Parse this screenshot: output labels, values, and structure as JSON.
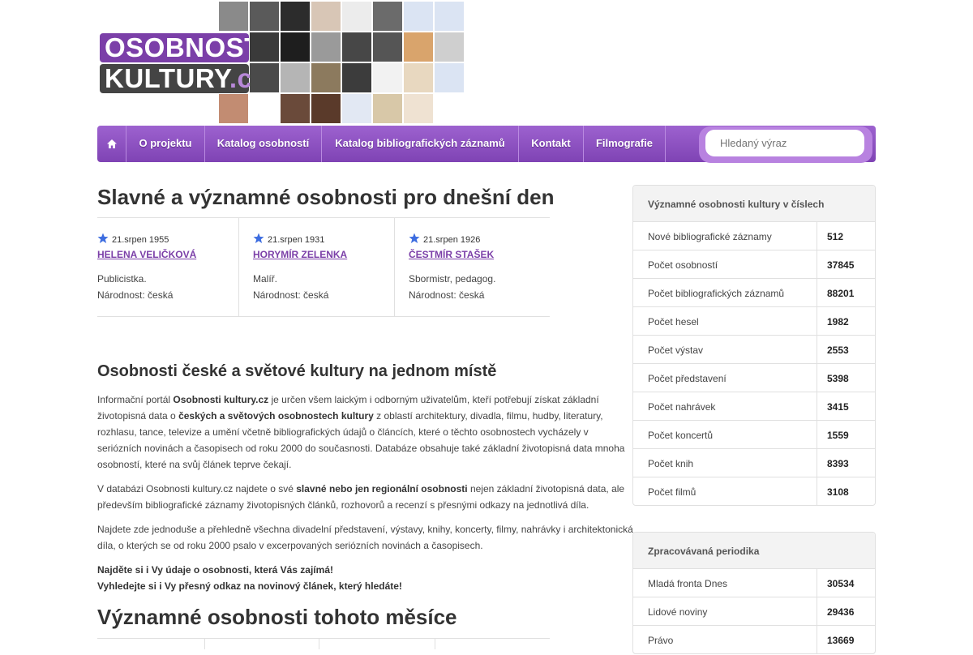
{
  "logo": {
    "line1": "OSOBNOSTI",
    "line2_main": "KULTURY",
    "line2_tld": ".cz"
  },
  "nav": {
    "home_icon": "home-icon",
    "items": [
      "O projektu",
      "Katalog osobností",
      "Katalog bibliografických záznamů",
      "Kontakt",
      "Filmografie"
    ],
    "search_placeholder": "Hledaný výraz"
  },
  "today": {
    "title": "Slavné a významné osobnosti pro dnešní den",
    "people": [
      {
        "date": "21.srpen 1955",
        "name": "HELENA VELIČKOVÁ",
        "desc": "Publicistka.",
        "nat": "Národnost: česká"
      },
      {
        "date": "21.srpen 1931",
        "name": "HORYMÍR ZELENKA",
        "desc": "Malíř.",
        "nat": "Národnost: česká"
      },
      {
        "date": "21.srpen 1926",
        "name": "ČESTMÍR STAŠEK",
        "desc": "Sbormistr, pedagog.",
        "nat": "Národnost: česká"
      }
    ]
  },
  "intro": {
    "title": "Osobnosti české a světové kultury na jednom místě",
    "p1_a": "Informační portál ",
    "p1_b": "Osobnosti kultury.cz",
    "p1_c": " je určen všem laickým i odborným uživatelům, kteří potřebují získat základní životopisná data o ",
    "p1_d": "českých a světových osobnostech kultury",
    "p1_e": " z oblastí architektury, divadla, filmu, hudby, literatury, rozhlasu, tance, televize a umění včetně bibliografických údajů o článcích, které o těchto osobnostech vycházely v seriózních novinách a časopisech od roku 2000 do současnosti. Databáze obsahuje také základní životopisná data mnoha osobností, které na svůj článek teprve čekají.",
    "p2_a": "V databázi Osobnosti kultury.cz najdete o své ",
    "p2_b": "slavné nebo jen regionální osobnosti",
    "p2_c": " nejen základní životopisná data, ale především bibliografické záznamy životopisných článků, rozhovorů a recenzí s přesnými odkazy na jednotlivá díla.",
    "p3": "Najdete zde jednoduše a přehledně všechna divadelní představení, výstavy, knihy, koncerty, filmy, nahrávky i architektonická díla, o kterých se od roku 2000 psalo v excerpovaných seriózních novinách a časopisech.",
    "cta1": "Najděte si i Vy údaje o osobnosti, která Vás zajímá!",
    "cta2": "Vyhledejte si i Vy přesný odkaz na novinový článek, který hledáte!"
  },
  "month": {
    "title": "Významné osobnosti tohoto měsíce"
  },
  "stats": {
    "title": "Významné osobnosti kultury v číslech",
    "rows": [
      {
        "label": "Nové bibliografické záznamy",
        "value": "512"
      },
      {
        "label": "Počet osobností",
        "value": "37845"
      },
      {
        "label": "Počet bibliografických záznamů",
        "value": "88201"
      },
      {
        "label": "Počet hesel",
        "value": "1982"
      },
      {
        "label": "Počet výstav",
        "value": "2553"
      },
      {
        "label": "Počet představení",
        "value": "5398"
      },
      {
        "label": "Počet nahrávek",
        "value": "3415"
      },
      {
        "label": "Počet koncertů",
        "value": "1559"
      },
      {
        "label": "Počet knih",
        "value": "8393"
      },
      {
        "label": "Počet filmů",
        "value": "3108"
      }
    ]
  },
  "periodika": {
    "title": "Zpracovávaná periodika",
    "rows": [
      {
        "label": "Mladá fronta Dnes",
        "value": "30534"
      },
      {
        "label": "Lidové noviny",
        "value": "29436"
      },
      {
        "label": "Právo",
        "value": "13669"
      }
    ]
  },
  "colors": {
    "accent": "#7b3fa8",
    "nav": "#8a4fbe",
    "logo_dark": "#444444"
  }
}
